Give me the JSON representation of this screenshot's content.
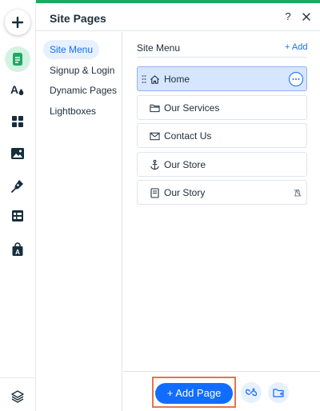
{
  "toolbar": {
    "items": [
      {
        "icon": "plus-icon",
        "label": "Add Elements"
      },
      {
        "icon": "page-icon",
        "label": "Pages"
      },
      {
        "icon": "theme-icon",
        "label": "Theme"
      },
      {
        "icon": "apps-icon",
        "label": "Apps"
      },
      {
        "icon": "media-icon",
        "label": "Media"
      },
      {
        "icon": "pen-icon",
        "label": "Blog"
      },
      {
        "icon": "table-icon",
        "label": "CMS"
      },
      {
        "icon": "bag-icon",
        "label": "Store"
      },
      {
        "icon": "layers-icon",
        "label": "Layers"
      }
    ]
  },
  "panel": {
    "title": "Site Pages",
    "help_glyph": "?",
    "accent_color": "#1eaa63"
  },
  "nav": {
    "items": [
      {
        "label": "Site Menu",
        "active": true
      },
      {
        "label": "Signup & Login",
        "active": false
      },
      {
        "label": "Dynamic Pages",
        "active": false
      },
      {
        "label": "Lightboxes",
        "active": false
      }
    ]
  },
  "content": {
    "title": "Site Menu",
    "add_label": "+ Add",
    "pages": [
      {
        "label": "Home",
        "icon": "home-icon",
        "selected": true
      },
      {
        "label": "Our Services",
        "icon": "folder-icon",
        "selected": false
      },
      {
        "label": "Contact Us",
        "icon": "envelope-icon",
        "selected": false
      },
      {
        "label": "Our Store",
        "icon": "anchor-icon",
        "selected": false
      },
      {
        "label": "Our Story",
        "icon": "document-icon",
        "selected": false,
        "hidden": true
      }
    ]
  },
  "footer": {
    "add_page_label": "+ Add Page",
    "link_icon": "link-icon",
    "folder_icon": "add-folder-icon",
    "brand_color": "#116dff",
    "highlight_color": "#e8734a"
  }
}
